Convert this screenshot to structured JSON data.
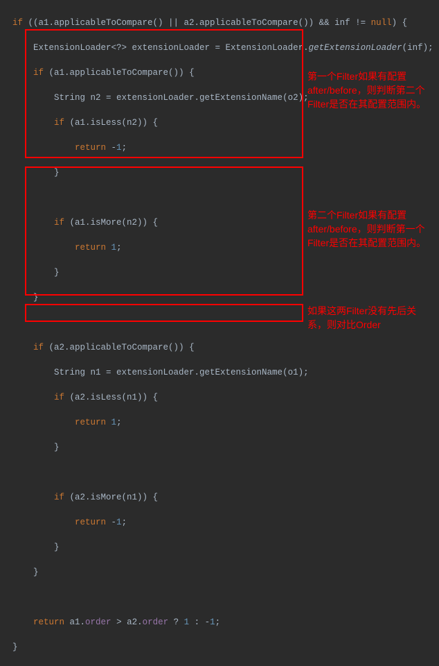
{
  "code": {
    "l1": "if ((a1.applicableToCompare() || a2.applicableToCompare()) && inf != null) {",
    "l2": "    ExtensionLoader<?> extensionLoader = ExtensionLoader.getExtensionLoader(inf);",
    "l3": "    if (a1.applicableToCompare()) {",
    "l4": "        String n2 = extensionLoader.getExtensionName(o2);",
    "l5": "        if (a1.isLess(n2)) {",
    "l6": "            return -1;",
    "l7": "        }",
    "l8": "",
    "l9": "        if (a1.isMore(n2)) {",
    "l10": "            return 1;",
    "l11": "        }",
    "l12": "    }",
    "l13": "",
    "l14": "    if (a2.applicableToCompare()) {",
    "l15": "        String n1 = extensionLoader.getExtensionName(o1);",
    "l16": "        if (a2.isLess(n1)) {",
    "l17": "            return 1;",
    "l18": "        }",
    "l19": "",
    "l20": "        if (a2.isMore(n1)) {",
    "l21": "            return -1;",
    "l22": "        }",
    "l23": "    }",
    "l24": "",
    "l25": "    return a1.order > a2.order ? 1 : -1;",
    "l26": "}"
  },
  "annotations": {
    "a1": "第一个Filter如果有配置after/before，则判断第二个Filter是否在其配置范围内。",
    "a2": "第二个Filter如果有配置after/before，则判断第一个Filter是否在其配置范围内。",
    "a3": "如果这两Filter没有先后关系，则对比Order"
  }
}
